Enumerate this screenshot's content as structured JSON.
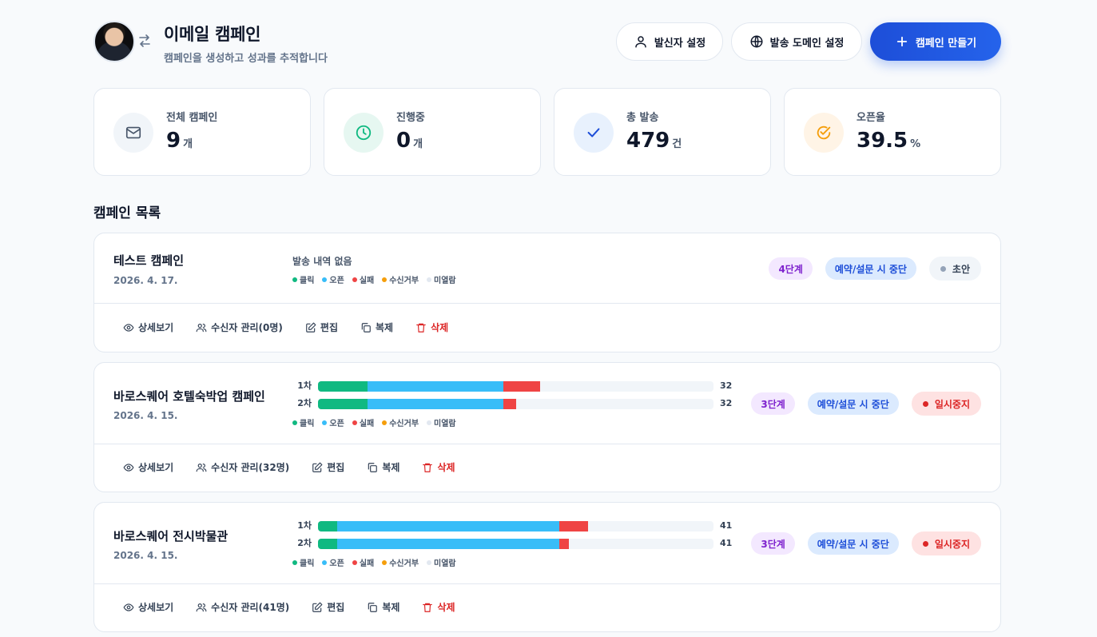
{
  "header": {
    "title": "이메일 캠페인",
    "subtitle": "캠페인을 생성하고 성과를 추적합니다",
    "buttons": {
      "sender": "발신자 설정",
      "domain": "발송 도메인 설정",
      "create": "캠페인 만들기"
    }
  },
  "stats": [
    {
      "label": "전체 캠페인",
      "value": "9",
      "unit": "개",
      "icon": "mail-icon"
    },
    {
      "label": "진행중",
      "value": "0",
      "unit": "개",
      "icon": "clock-icon"
    },
    {
      "label": "총 발송",
      "value": "479",
      "unit": "건",
      "icon": "check-icon"
    },
    {
      "label": "오픈율",
      "value": "39.5",
      "unit": "%",
      "icon": "check-circle-icon"
    }
  ],
  "section_title": "캠페인 목록",
  "legend": {
    "click": "클릭",
    "open": "오픈",
    "fail": "실패",
    "unsubscribe": "수신거부",
    "unread": "미열람"
  },
  "colors": {
    "click": "#10b981",
    "open": "#38bdf8",
    "fail": "#ef4444",
    "unsubscribe": "#f59e0b",
    "unread": "#e2e8f0"
  },
  "campaigns": [
    {
      "name": "테스트 캠페인",
      "date": "2026. 4. 17.",
      "no_send": "발송 내역 없음",
      "step": "4단계",
      "rule": "예약/설문 시 중단",
      "status": "초안",
      "actions": {
        "detail": "상세보기",
        "recipients": "수신자 관리(0명)",
        "edit": "편집",
        "copy": "복제",
        "delete": "삭제"
      }
    },
    {
      "name": "바로스퀘어 호텔숙박업 캠페인",
      "date": "2026. 4. 15.",
      "rounds": [
        {
          "label": "1차",
          "total": "32",
          "click": 4,
          "open": 11,
          "fail": 3
        },
        {
          "label": "2차",
          "total": "32",
          "click": 4,
          "open": 11,
          "fail": 1
        }
      ],
      "step": "3단계",
      "rule": "예약/설문 시 중단",
      "status": "일시중지",
      "actions": {
        "detail": "상세보기",
        "recipients": "수신자 관리(32명)",
        "edit": "편집",
        "copy": "복제",
        "delete": "삭제"
      }
    },
    {
      "name": "바로스퀘어 전시박물관",
      "date": "2026. 4. 15.",
      "rounds": [
        {
          "label": "1차",
          "total": "41",
          "click": 2,
          "open": 23,
          "fail": 3
        },
        {
          "label": "2차",
          "total": "41",
          "click": 2,
          "open": 23,
          "fail": 1
        }
      ],
      "step": "3단계",
      "rule": "예약/설문 시 중단",
      "status": "일시중지",
      "actions": {
        "detail": "상세보기",
        "recipients": "수신자 관리(41명)",
        "edit": "편집",
        "copy": "복제",
        "delete": "삭제"
      }
    }
  ]
}
